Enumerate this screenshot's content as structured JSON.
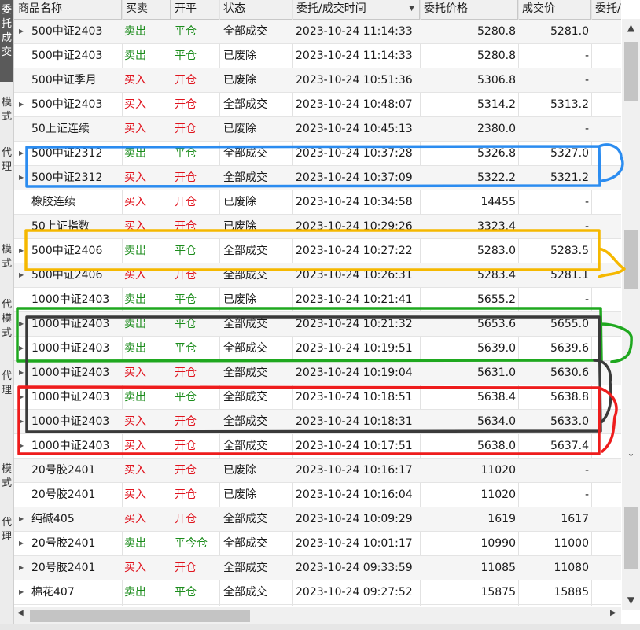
{
  "side_tabs": [
    {
      "label": "委托成交",
      "active": true
    },
    {
      "label": "模式",
      "active": false
    },
    {
      "label": "代理",
      "active": false
    },
    {
      "label": "模式",
      "active": false
    },
    {
      "label": "代模式",
      "active": false
    },
    {
      "label": "代理",
      "active": false
    },
    {
      "label": "模式",
      "active": false
    },
    {
      "label": "代理",
      "active": false
    }
  ],
  "columns": [
    "商品名称",
    "买卖",
    "开平",
    "状态",
    "委托/成交时间",
    "委托价格",
    "成交价",
    "委托/成"
  ],
  "colors": {
    "buy": "#e0141e",
    "sell": "#1c8c1c",
    "blue_box": "#2b8cf0",
    "orange_box": "#f5b800",
    "green_box": "#1fa81f",
    "dark_box": "#3a3a3a",
    "red_box": "#ee1c1c"
  },
  "rows": [
    {
      "name": "500中证2403",
      "side": "卖出",
      "oc": "平仓",
      "status": "全部成交",
      "time": "2023-10-24 11:14:33",
      "price": "5280.8",
      "deal": "5281.0",
      "expand": true
    },
    {
      "name": "500中证2403",
      "side": "卖出",
      "oc": "平仓",
      "status": "已废除",
      "time": "2023-10-24 11:14:33",
      "price": "5280.8",
      "deal": "-",
      "expand": false
    },
    {
      "name": "500中证季月",
      "side": "买入",
      "oc": "开仓",
      "status": "已废除",
      "time": "2023-10-24 10:51:36",
      "price": "5306.8",
      "deal": "-",
      "expand": false
    },
    {
      "name": "500中证2403",
      "side": "买入",
      "oc": "开仓",
      "status": "全部成交",
      "time": "2023-10-24 10:48:07",
      "price": "5314.2",
      "deal": "5313.2",
      "expand": true
    },
    {
      "name": "50上证连续",
      "side": "买入",
      "oc": "开仓",
      "status": "已废除",
      "time": "2023-10-24 10:45:13",
      "price": "2380.0",
      "deal": "-",
      "expand": false
    },
    {
      "name": "500中证2312",
      "side": "卖出",
      "oc": "平仓",
      "status": "全部成交",
      "time": "2023-10-24 10:37:28",
      "price": "5326.8",
      "deal": "5327.0",
      "expand": true
    },
    {
      "name": "500中证2312",
      "side": "买入",
      "oc": "开仓",
      "status": "全部成交",
      "time": "2023-10-24 10:37:09",
      "price": "5322.2",
      "deal": "5321.2",
      "expand": true
    },
    {
      "name": "橡胶连续",
      "side": "买入",
      "oc": "开仓",
      "status": "已废除",
      "time": "2023-10-24 10:34:58",
      "price": "14455",
      "deal": "-",
      "expand": false
    },
    {
      "name": "50上证指数",
      "side": "买入",
      "oc": "开仓",
      "status": "已废除",
      "time": "2023-10-24 10:29:26",
      "price": "3323.4",
      "deal": "-",
      "expand": false
    },
    {
      "name": "500中证2406",
      "side": "卖出",
      "oc": "平仓",
      "status": "全部成交",
      "time": "2023-10-24 10:27:22",
      "price": "5283.0",
      "deal": "5283.5",
      "expand": true
    },
    {
      "name": "500中证2406",
      "side": "买入",
      "oc": "开仓",
      "status": "全部成交",
      "time": "2023-10-24 10:26:31",
      "price": "5283.4",
      "deal": "5281.1",
      "expand": true
    },
    {
      "name": "1000中证2403",
      "side": "卖出",
      "oc": "平仓",
      "status": "已废除",
      "time": "2023-10-24 10:21:41",
      "price": "5655.2",
      "deal": "-",
      "expand": false
    },
    {
      "name": "1000中证2403",
      "side": "卖出",
      "oc": "平仓",
      "status": "全部成交",
      "time": "2023-10-24 10:21:32",
      "price": "5653.6",
      "deal": "5655.0",
      "expand": true
    },
    {
      "name": "1000中证2403",
      "side": "卖出",
      "oc": "平仓",
      "status": "全部成交",
      "time": "2023-10-24 10:19:51",
      "price": "5639.0",
      "deal": "5639.6",
      "expand": true
    },
    {
      "name": "1000中证2403",
      "side": "买入",
      "oc": "开仓",
      "status": "全部成交",
      "time": "2023-10-24 10:19:04",
      "price": "5631.0",
      "deal": "5630.6",
      "expand": true
    },
    {
      "name": "1000中证2403",
      "side": "卖出",
      "oc": "平仓",
      "status": "全部成交",
      "time": "2023-10-24 10:18:51",
      "price": "5638.4",
      "deal": "5638.8",
      "expand": true
    },
    {
      "name": "1000中证2403",
      "side": "买入",
      "oc": "开仓",
      "status": "全部成交",
      "time": "2023-10-24 10:18:31",
      "price": "5634.0",
      "deal": "5633.0",
      "expand": true
    },
    {
      "name": "1000中证2403",
      "side": "买入",
      "oc": "开仓",
      "status": "全部成交",
      "time": "2023-10-24 10:17:51",
      "price": "5638.0",
      "deal": "5637.4",
      "expand": true
    },
    {
      "name": "20号胶2401",
      "side": "买入",
      "oc": "开仓",
      "status": "已废除",
      "time": "2023-10-24 10:16:17",
      "price": "11020",
      "deal": "-",
      "expand": false
    },
    {
      "name": "20号胶2401",
      "side": "买入",
      "oc": "开仓",
      "status": "已废除",
      "time": "2023-10-24 10:16:04",
      "price": "11020",
      "deal": "-",
      "expand": false
    },
    {
      "name": "纯碱405",
      "side": "买入",
      "oc": "开仓",
      "status": "全部成交",
      "time": "2023-10-24 10:09:29",
      "price": "1619",
      "deal": "1617",
      "expand": true
    },
    {
      "name": "20号胶2401",
      "side": "卖出",
      "oc": "平今仓",
      "status": "全部成交",
      "time": "2023-10-24 10:01:17",
      "price": "10990",
      "deal": "11000",
      "expand": true
    },
    {
      "name": "20号胶2401",
      "side": "买入",
      "oc": "开仓",
      "status": "全部成交",
      "time": "2023-10-24 09:33:59",
      "price": "11085",
      "deal": "11080",
      "expand": true
    },
    {
      "name": "棉花407",
      "side": "卖出",
      "oc": "平仓",
      "status": "全部成交",
      "time": "2023-10-24 09:27:52",
      "price": "15875",
      "deal": "15885",
      "expand": true
    }
  ],
  "scrollbar": {
    "up": "▲",
    "down": "▼",
    "left": "◀",
    "right": "▶",
    "mid_down": "⌄"
  }
}
